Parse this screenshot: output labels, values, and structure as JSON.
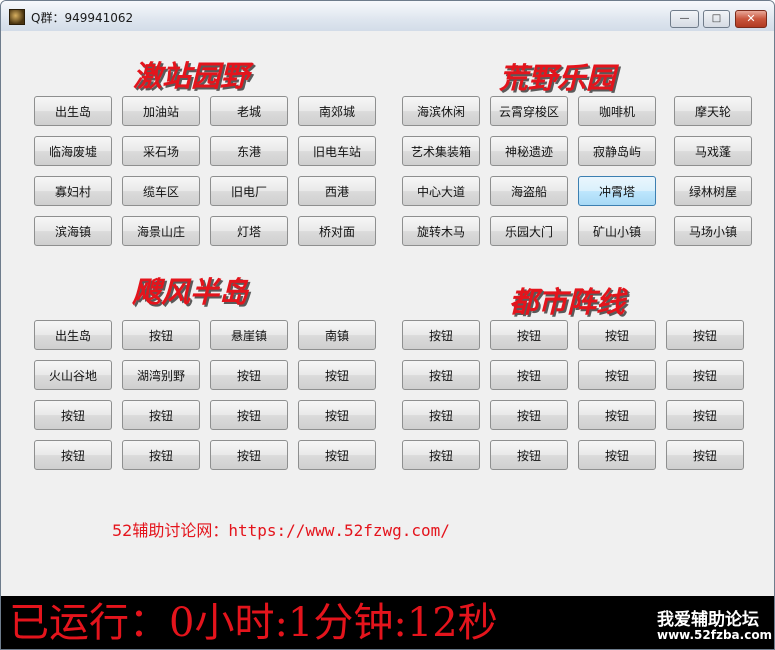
{
  "window": {
    "title": "Q群：949941062",
    "minimize": "—",
    "maximize": "□",
    "close": "✕"
  },
  "sections": {
    "s1": {
      "title": "激站园野",
      "buttons": [
        "出生岛",
        "加油站",
        "老城",
        "南郊城",
        "临海废墟",
        "采石场",
        "东港",
        "旧电车站",
        "寡妇村",
        "缆车区",
        "旧电厂",
        "西港",
        "滨海镇",
        "海景山庄",
        "灯塔",
        "桥对面"
      ]
    },
    "s2": {
      "title": "荒野乐园",
      "buttons": [
        "海滨休闲",
        "云霄穿梭区",
        "咖啡机",
        "摩天轮",
        "艺术集装箱",
        "神秘遗迹",
        "寂静岛屿",
        "马戏蓬",
        "中心大道",
        "海盗船",
        "冲霄塔",
        "绿林树屋",
        "旋转木马",
        "乐园大门",
        "矿山小镇",
        "马场小镇"
      ]
    },
    "s3": {
      "title": "飕风半岛",
      "buttons": [
        "出生岛",
        "按钮",
        "悬崖镇",
        "南镇",
        "火山谷地",
        "湖湾别野",
        "按钮",
        "按钮",
        "按钮",
        "按钮",
        "按钮",
        "按钮",
        "按钮",
        "按钮",
        "按钮",
        "按钮"
      ]
    },
    "s4": {
      "title": "都市阵线",
      "buttons": [
        "按钮",
        "按钮",
        "按钮",
        "按钮",
        "按钮",
        "按钮",
        "按钮",
        "按钮",
        "按钮",
        "按钮",
        "按钮",
        "按钮",
        "按钮",
        "按钮",
        "按钮",
        "按钮"
      ]
    }
  },
  "link": {
    "label": "52辅助讨论网：",
    "url": "https://www.52fzwg.com/"
  },
  "status": {
    "runtime": "已运行：0小时:1分钟:12秒",
    "watermark_title": "我爱辅助论坛",
    "watermark_url": "www.52fzba.com"
  },
  "colors": {
    "accent_red": "#e4141c",
    "status_bg": "#000000",
    "hover_button": "#bee6fd"
  },
  "icons": {
    "app_icon": "app-icon"
  },
  "state": {
    "hovered_button": "冲霄塔"
  }
}
